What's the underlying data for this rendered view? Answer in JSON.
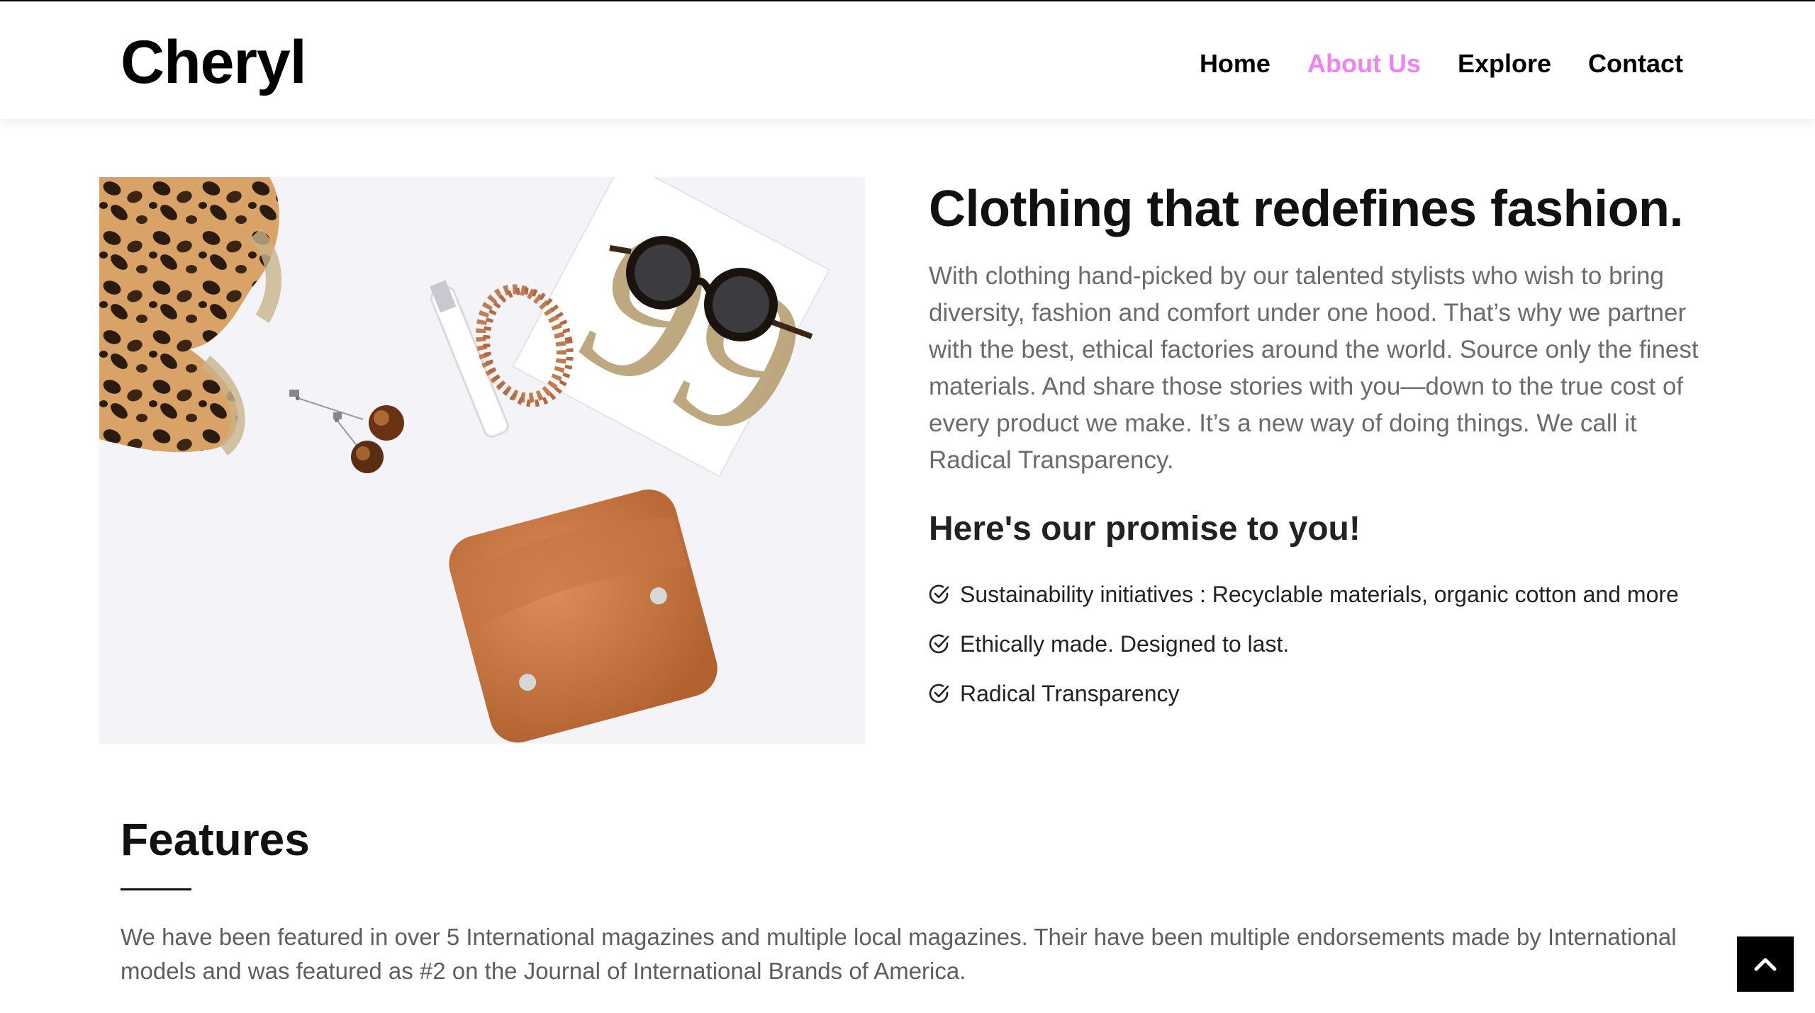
{
  "brand": "Cheryl",
  "nav": {
    "home": "Home",
    "about": "About Us",
    "explore": "Explore",
    "contact": "Contact",
    "active_color": "#ee82ee"
  },
  "hero_image": {
    "depicts": [
      "leopard-print-shoes",
      "tortoiseshell-earrings",
      "perfume-vial",
      "wooden-bead-bracelet",
      "tortoiseshell-sunglasses",
      "book",
      "tan-leather-pouch"
    ]
  },
  "about": {
    "heading": "Clothing that redefines fashion.",
    "description": "With clothing hand-picked by our talented stylists who wish to bring diversity, fashion and comfort under one hood. That’s why we partner with the best, ethical factories around the world. Source only the finest materials. And share those stories with you—down to the true cost of every product we make. It’s a new way of doing things. We call it Radical Transparency.",
    "promise_heading": "Here's our promise to you!",
    "promises": [
      "Sustainability initiatives : Recyclable materials, organic cotton and more",
      "Ethically made. Designed to last.",
      "Radical Transparency"
    ],
    "promise_icon": "check-circle-icon"
  },
  "features": {
    "heading": "Features",
    "text": "We have been featured in over 5 International magazines and multiple local magazines. Their have been multiple endorsements made by International models and was featured as #2 on the Journal of International Brands of America."
  },
  "back_to_top_icon": "chevron-up-icon"
}
